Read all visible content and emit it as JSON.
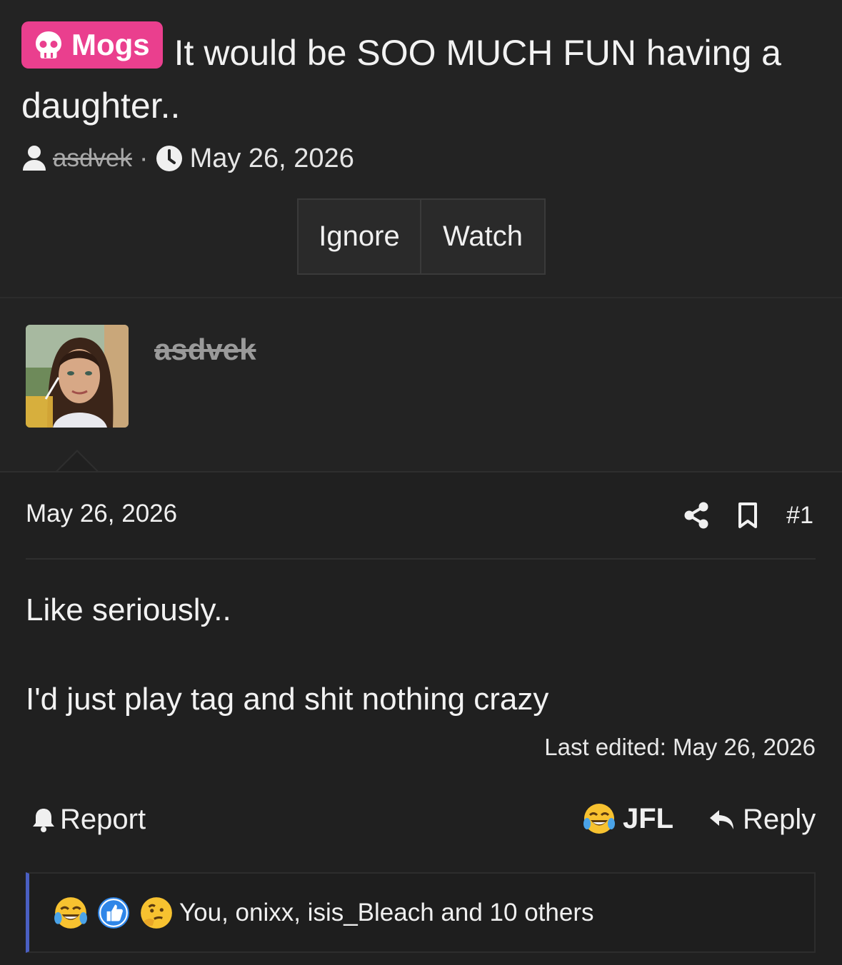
{
  "thread": {
    "prefix": "Mogs",
    "title": "It would be SOO MUCH FUN having a daughter..",
    "author": "asdvek",
    "separator": "·",
    "date": "May 26, 2026",
    "buttons": {
      "ignore": "Ignore",
      "watch": "Watch"
    }
  },
  "post": {
    "username": "asdvek",
    "date": "May 26, 2026",
    "number": "#1",
    "body": [
      "Like seriously..",
      "I'd just play tag and shit nothing crazy"
    ],
    "last_edited": "Last edited: May 26, 2026",
    "actions": {
      "report": "Report",
      "jfl": "JFL",
      "reply": "Reply"
    },
    "reactions": {
      "icons": [
        "crying-laughing-icon",
        "thumbs-up-icon",
        "thinking-icon"
      ],
      "summary": "You, onixx, isis_Bleach and 10 others"
    }
  },
  "colors": {
    "background": "#202020",
    "prefix_badge": "#ea3f8e",
    "reaction_accent": "#4a5fc2"
  }
}
